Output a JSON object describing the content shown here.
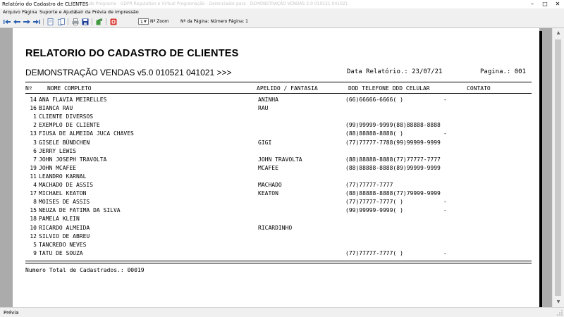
{
  "window": {
    "title": "Relatório do Cadastro de CLIENTES",
    "title_ghost": "Gerador de Programa - GDPR   Regulation e Virtual Programação - Gerenciador para - DEMONSTRAÇÃO VENDAS 2.0 010521 041021"
  },
  "menu": {
    "items": [
      "Arquivo",
      "Página",
      "Suporte e Ajuda",
      "Sair da Prévia de Impressão"
    ]
  },
  "toolbar": {
    "icons": [
      "first-page-icon",
      "previous-page-icon",
      "next-page-icon",
      "last-page-icon",
      "single-page-icon",
      "two-pages-icon",
      "print-icon",
      "save-icon",
      "export-icon",
      "pdf-icon"
    ],
    "zoom_value": "1",
    "zoom_label": "Nº Zoom",
    "page_label": "Nº da Página: Número Página: 1"
  },
  "report": {
    "title": "RELATORIO DO CADASTRO DE CLIENTES",
    "subtitle": "DEMONSTRAÇÃO VENDAS v5.0 010521 041021 >>>",
    "date": "Data Relatório.: 23/07/21",
    "page": "Pagina.: 001",
    "columns": [
      "Nº",
      "NOME COMPLETO",
      "APELIDO / FANTASIA",
      "DDD TELEFONE DDD CELULAR",
      "CONTATO"
    ],
    "rows": [
      {
        "code": "14",
        "name": "ANA FLAVIA MEIRELLES",
        "nickname": "ANINHA",
        "phones": "(66)66666-6666(  )",
        "contact": "-"
      },
      {
        "code": "16",
        "name": "BIANCA RAU",
        "nickname": "RAU",
        "phones": "",
        "contact": ""
      },
      {
        "code": "1",
        "name": "CLIENTE DIVERSOS",
        "nickname": "",
        "phones": "",
        "contact": ""
      },
      {
        "code": "2",
        "name": "EXEMPLO DE CLIENTE",
        "nickname": "",
        "phones": "(99)99999-9999(88)88888-8888",
        "contact": ""
      },
      {
        "code": "13",
        "name": "FIUSA DE ALMEIDA JUCA CHAVES",
        "nickname": "",
        "phones": "(88)88888-8888(  )",
        "contact": "-"
      },
      {
        "code": "3",
        "name": "GISELE BÜNDCHEN",
        "nickname": "GIGI",
        "phones": "(77)77777-7788(99)99999-9999",
        "contact": ""
      },
      {
        "code": "6",
        "name": "JERRY LEWIS",
        "nickname": "",
        "phones": "",
        "contact": ""
      },
      {
        "code": "7",
        "name": "JOHN JOSEPH TRAVOLTA",
        "nickname": "JOHN TRAVOLTA",
        "phones": "(88)88888-8888(77)77777-7777",
        "contact": ""
      },
      {
        "code": "19",
        "name": "JOHN MCAFEE",
        "nickname": "MCAFEE",
        "phones": "(88)88888-8888(89)99999-9999",
        "contact": ""
      },
      {
        "code": "11",
        "name": "LEANDRO KARNAL",
        "nickname": "",
        "phones": "",
        "contact": ""
      },
      {
        "code": "4",
        "name": "MACHADO DE ASSIS",
        "nickname": "MACHADO",
        "phones": "(77)77777-7777",
        "contact": ""
      },
      {
        "code": "17",
        "name": "MICHAEL KEATON",
        "nickname": "KEATON",
        "phones": "(88)88888-8888(77)79999-9999",
        "contact": ""
      },
      {
        "code": "8",
        "name": "MOISES DE ASSIS",
        "nickname": "",
        "phones": "(77)77777-7777(  )",
        "contact": "-"
      },
      {
        "code": "15",
        "name": "NEUZA DE FATIMA DA SILVA",
        "nickname": "",
        "phones": "(99)99999-9999(  )",
        "contact": "-"
      },
      {
        "code": "18",
        "name": "PAMELA KLEIN",
        "nickname": "",
        "phones": "",
        "contact": ""
      },
      {
        "code": "10",
        "name": "RICARDO ALMEIDA",
        "nickname": "RICARDINHO",
        "phones": "",
        "contact": ""
      },
      {
        "code": "12",
        "name": "SILVIO DE ABREU",
        "nickname": "",
        "phones": "",
        "contact": ""
      },
      {
        "code": "5",
        "name": "TANCREDO NEVES",
        "nickname": "",
        "phones": "",
        "contact": ""
      },
      {
        "code": "9",
        "name": "TATU DE SOUZA",
        "nickname": "",
        "phones": "(77)77777-7777(  )",
        "contact": "-"
      }
    ],
    "total": "Numero Total de Cadastrados.: 00019"
  },
  "status": {
    "text": "Prévia"
  }
}
